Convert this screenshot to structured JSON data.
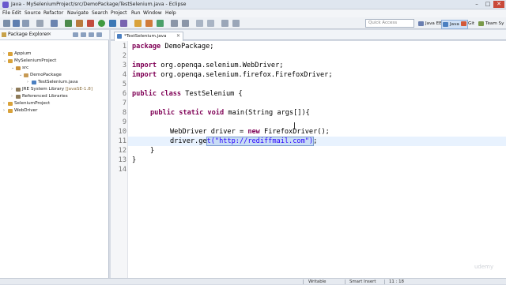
{
  "window": {
    "title": "Java - MySeleniumProject/src/DemoPackage/TestSelenium.java - Eclipse"
  },
  "menu": [
    "File",
    "Edit",
    "Source",
    "Refactor",
    "Navigate",
    "Search",
    "Project",
    "Run",
    "Window",
    "Help"
  ],
  "toolbar": {
    "quick_access_placeholder": "Quick Access",
    "perspectives": [
      "Java EE",
      "Java",
      "Git",
      "Team Sy"
    ]
  },
  "package_explorer": {
    "title": "Package Explorer",
    "tree": [
      {
        "label": "Appium",
        "level": 0,
        "expanded": false
      },
      {
        "label": "MySeleniumProject",
        "level": 0,
        "expanded": true
      },
      {
        "label": "src",
        "level": 1,
        "expanded": true
      },
      {
        "label": "DemoPackage",
        "level": 2,
        "expanded": true
      },
      {
        "label": "TestSelenium.java",
        "level": 3,
        "expanded": false
      },
      {
        "label": "JRE System Library",
        "suffix": "[JavaSE-1.8]",
        "level": 1,
        "expanded": false
      },
      {
        "label": "Referenced Libraries",
        "level": 1,
        "expanded": false
      },
      {
        "label": "SeleniumProject",
        "level": 0,
        "expanded": false
      },
      {
        "label": "WebDriver",
        "level": 0,
        "expanded": false
      }
    ]
  },
  "editor": {
    "tab_label": "*TestSelenium.java",
    "line_numbers": [
      "1",
      "2",
      "3",
      "4",
      "5",
      "6",
      "7",
      "8",
      "9",
      "10",
      "11",
      "12",
      "13",
      "14"
    ],
    "lines": {
      "l1_kw": "package",
      "l1_rest": " DemoPackage;",
      "l3_kw": "import",
      "l3_rest": " org.openqa.selenium.WebDriver;",
      "l4_kw": "import",
      "l4_rest": " org.openqa.selenium.firefox.FirefoxDriver;",
      "l6_kw": "public class",
      "l6_rest": " TestSelenium {",
      "l8_kw": "public static void",
      "l8_rest": " main(String args[]){",
      "l10_a": "WebDriver driver = ",
      "l10_kw": "new",
      "l10_b": " FirefoxDriver();",
      "l11_a": "driver.ge",
      "l11_sel": "t(\"http://rediffmail.com\")",
      "l11_b": ";",
      "l12": "}",
      "l13": "}"
    }
  },
  "status_bar": {
    "mode": "Writable",
    "insert": "Smart Insert",
    "position": "11 : 18"
  },
  "watermark": "udemy"
}
